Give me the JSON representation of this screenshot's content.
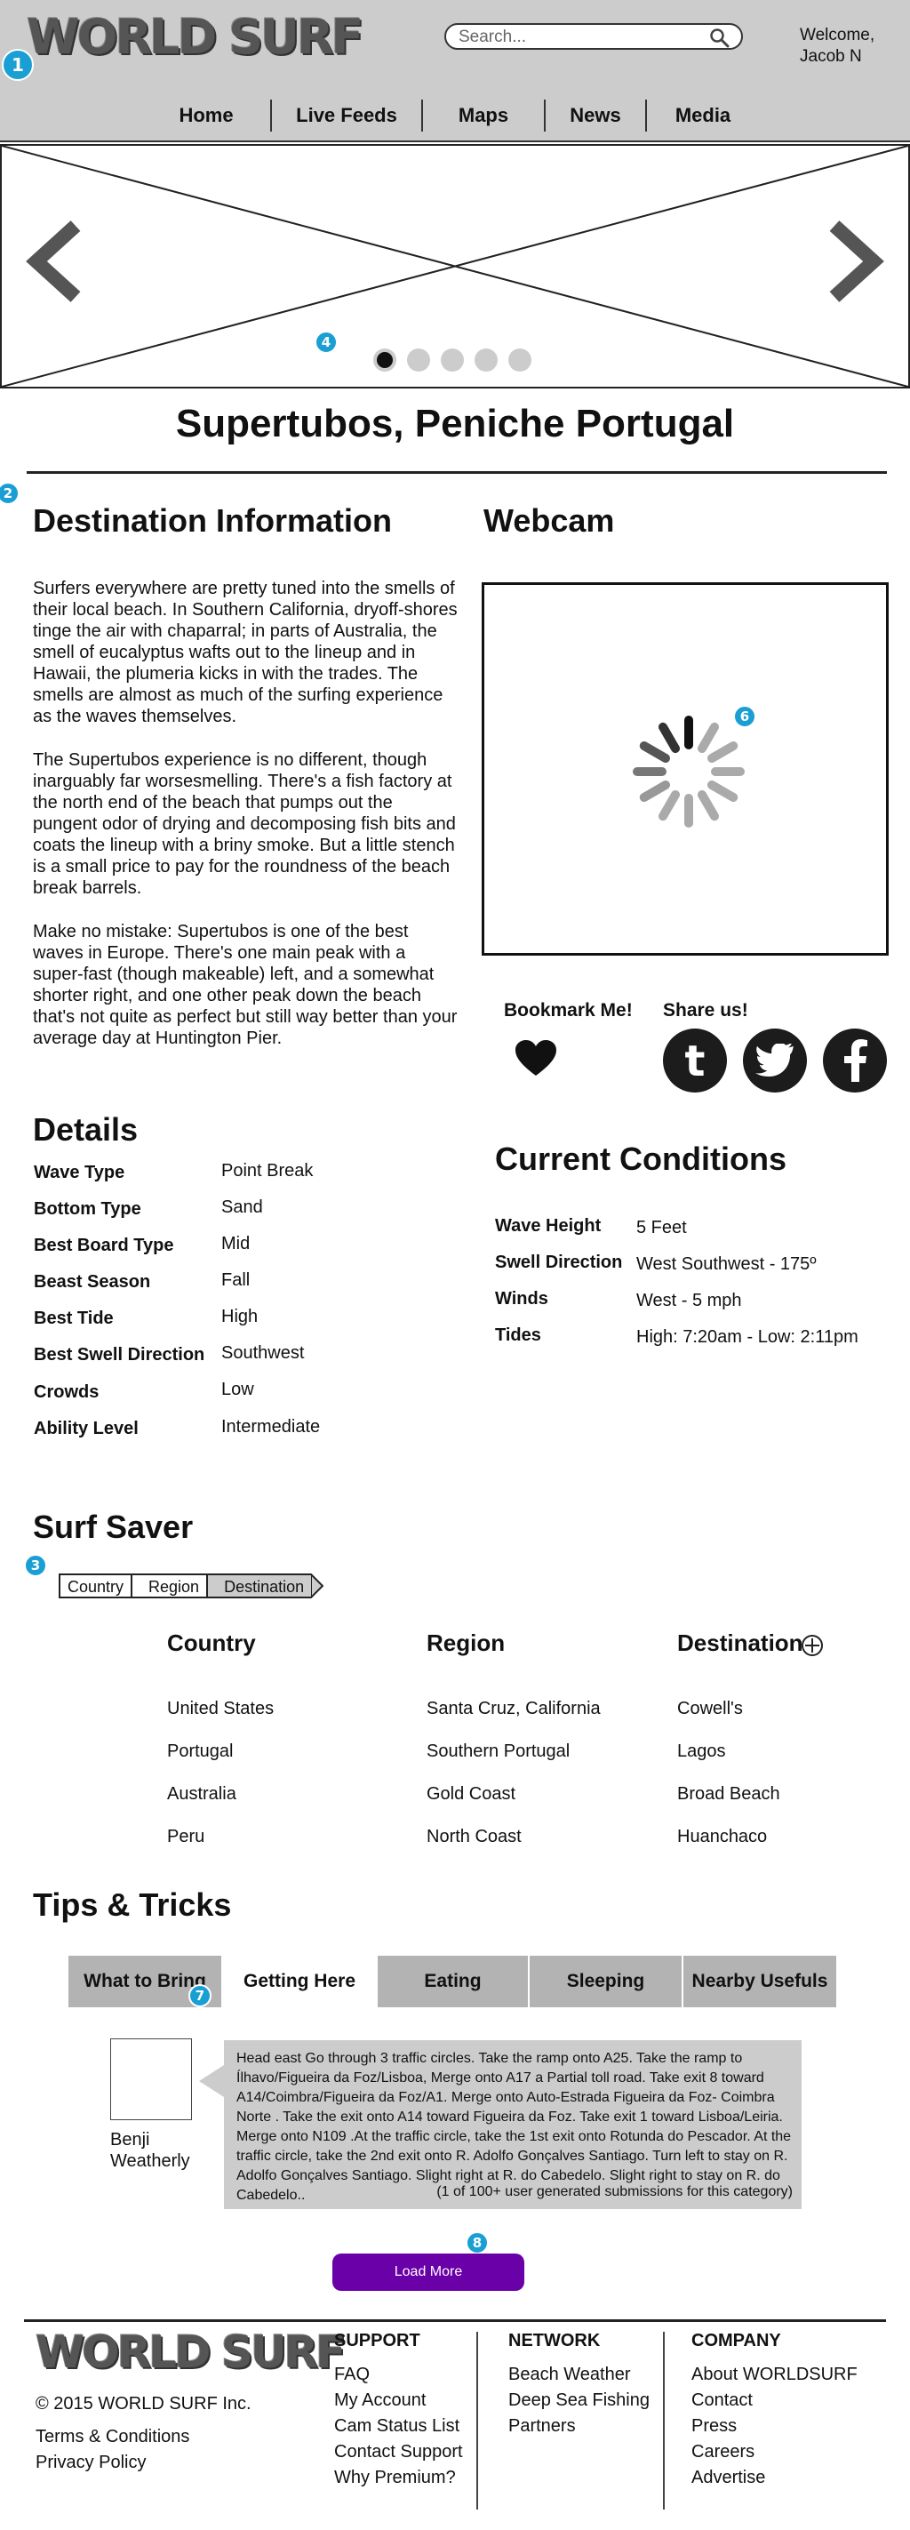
{
  "header": {
    "logo": "WORLD SURF",
    "search_placeholder": "Search...",
    "welcome": "Welcome, Jacob N",
    "nav": [
      "Home",
      "Live Feeds",
      "Maps",
      "News",
      "Media"
    ]
  },
  "markers": [
    "1",
    "2",
    "3",
    "4",
    "6",
    "7",
    "8"
  ],
  "carousel": {
    "slide_count": 5,
    "active_index": 0
  },
  "page_title": "Supertubos, Peniche Portugal",
  "destination": {
    "heading": "Destination Information",
    "paragraphs": [
      "Surfers everywhere are pretty tuned into the smells of their local beach. In Southern California, dryoff-shores tinge the air with chaparral; in parts of Australia, the smell of eucalyptus wafts out to the lineup and in Hawaii, the plumeria kicks in with the trades. The smells are almost as much of the surfing experience as the waves themselves.",
      "The Supertubos experience is no different, though inarguably far worsesmelling. There's a fish factory at the north end of the beach that pumps out the pungent odor of drying and decomposing fish bits and coats the lineup with a briny smoke. But a little stench is a small price to pay for the roundness of the beach break barrels.",
      "Make no mistake: Supertubos is one of the best waves in Europe. There's one main peak with a super-fast (though makeable) left, and a somewhat shorter right, and one other peak down the beach that's  not quite as perfect but still way better than your average day at Huntington Pier."
    ]
  },
  "webcam": {
    "heading": "Webcam"
  },
  "social": {
    "bookmark_label": "Bookmark Me!",
    "share_label": "Share us!",
    "share_icons": [
      "t",
      "bird",
      "f"
    ]
  },
  "details": {
    "heading": "Details",
    "rows": [
      {
        "key": "Wave Type",
        "value": "Point Break"
      },
      {
        "key": "Bottom Type",
        "value": "Sand"
      },
      {
        "key": "Best Board Type",
        "value": "Mid"
      },
      {
        "key": "Beast Season",
        "value": "Fall"
      },
      {
        "key": "Best Tide",
        "value": "High"
      },
      {
        "key": "Best Swell Direction",
        "value": "Southwest"
      },
      {
        "key": "Crowds",
        "value": "Low"
      },
      {
        "key": "Ability Level",
        "value": "Intermediate"
      }
    ]
  },
  "conditions": {
    "heading": "Current Conditions",
    "rows": [
      {
        "key": "Wave Height",
        "value": "5 Feet"
      },
      {
        "key": "Swell Direction",
        "value": "West Southwest - 175º"
      },
      {
        "key": "Winds",
        "value": "West - 5 mph"
      },
      {
        "key": "Tides",
        "value": "High: 7:20am - Low: 2:11pm"
      }
    ]
  },
  "surf_saver": {
    "heading": "Surf Saver",
    "breadcrumb": [
      "Country",
      "Region",
      "Destination"
    ],
    "columns": [
      {
        "heading": "Country",
        "items": [
          "United States",
          "Portugal",
          "Australia",
          "Peru"
        ]
      },
      {
        "heading": "Region",
        "items": [
          "Santa Cruz, California",
          "Southern Portugal",
          "Gold Coast",
          "North Coast"
        ]
      },
      {
        "heading": "Destination",
        "items": [
          "Cowell's",
          "Lagos",
          "Broad Beach",
          "Huanchaco"
        ]
      }
    ]
  },
  "tips": {
    "heading": "Tips & Tricks",
    "tabs": [
      "What to Bring",
      "Getting Here",
      "Eating",
      "Sleeping",
      "Nearby Usefuls"
    ],
    "active_tab": 1,
    "author": "Benji Weatherly",
    "text": "Head east Go through 3 traffic circles. Take the ramp onto A25. Take the ramp to Ílhavo/Figueira da Foz/Lisboa, Merge onto A17 a Partial toll road. Take exit 8 toward A14/Coimbra/Figueira da Foz/A1. Merge onto Auto-Estrada Figueira da Foz- Coimbra Norte . Take the exit onto A14 toward Figueira da Foz. Take exit 1 toward Lisboa/Leiria. Merge onto N109 .At the traffic circle, take the 1st exit onto Rotunda do Pescador. At the traffic circle, take the 2nd exit onto R. Adolfo Gonçalves Santiago. Turn left to stay on R. Adolfo Gonçalves Santiago. Slight right at R. do Cabedelo. Slight right to stay on R. do Cabedelo..",
    "count": "(1 of 100+ user generated submissions for this category)",
    "load_more": "Load More"
  },
  "footer": {
    "logo": "WORLD SURF",
    "copyright": "© 2015 WORLD SURF Inc.",
    "legal": [
      "Terms & Conditions",
      "Privacy Policy"
    ],
    "columns": [
      {
        "heading": "SUPPORT",
        "items": [
          "FAQ",
          "My Account",
          "Cam Status List",
          "Contact Support",
          "Why Premium?"
        ]
      },
      {
        "heading": "NETWORK",
        "items": [
          "Beach Weather",
          "Deep Sea Fishing",
          "Partners"
        ]
      },
      {
        "heading": "COMPANY",
        "items": [
          "About WORLDSURF",
          "Contact",
          "Press",
          "Careers",
          "Advertise"
        ]
      }
    ]
  }
}
